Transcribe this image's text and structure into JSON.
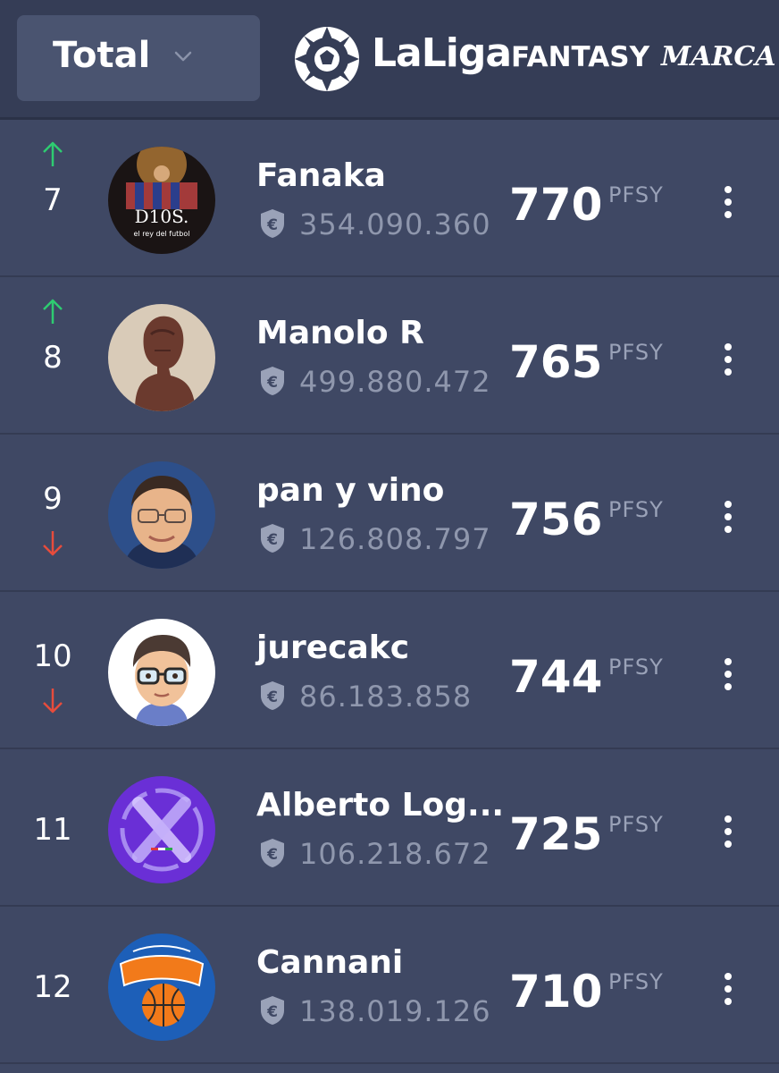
{
  "filter": {
    "selected": "Total"
  },
  "brand": {
    "laliga": "LaLiga",
    "fantasy": "FANTASY",
    "marca": "MARCA"
  },
  "colors": {
    "up": "#2ecc71",
    "down": "#e74c3c"
  },
  "unit_label": "PFSY",
  "rows": [
    {
      "rank": "7",
      "trend": "up",
      "name": "Fanaka",
      "value": "354.090.360",
      "points": "770",
      "avatar": "messi-poster"
    },
    {
      "rank": "8",
      "trend": "up",
      "name": "Manolo R",
      "value": "499.880.472",
      "points": "765",
      "avatar": "bust-sculpture"
    },
    {
      "rank": "9",
      "trend": "down",
      "name": "pan y vino",
      "value": "126.808.797",
      "points": "756",
      "avatar": "man-photo"
    },
    {
      "rank": "10",
      "trend": "down",
      "name": "jurecakc",
      "value": "86.183.858",
      "points": "744",
      "avatar": "memoji-glasses"
    },
    {
      "rank": "11",
      "trend": "none",
      "name": "Alberto Log...",
      "value": "106.218.672",
      "points": "725",
      "avatar": "purple-x-logo"
    },
    {
      "rank": "12",
      "trend": "none",
      "name": "Cannani",
      "value": "138.019.126",
      "points": "710",
      "avatar": "knicks-logo"
    }
  ]
}
